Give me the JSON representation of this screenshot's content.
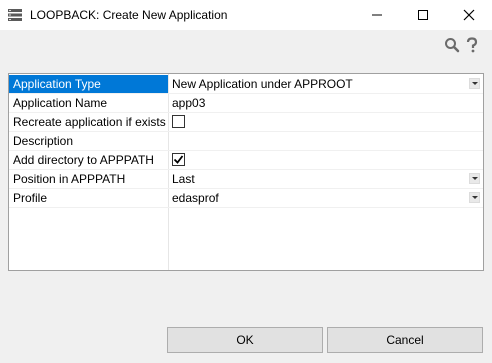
{
  "window": {
    "title": "LOOPBACK: Create New Application"
  },
  "icons": {
    "app": "server-stack-icon",
    "minimize": "minimize-icon",
    "maximize": "maximize-icon",
    "close": "close-icon",
    "search": "search-icon",
    "help": "help-icon"
  },
  "properties": [
    {
      "label": "Application Type",
      "value": "New Application under APPROOT",
      "control": "dropdown",
      "selected": true
    },
    {
      "label": "Application Name",
      "value": "app03",
      "control": "text"
    },
    {
      "label": "Recreate application if exists",
      "value": "",
      "control": "checkbox",
      "checked": false
    },
    {
      "label": "Description",
      "value": "",
      "control": "text"
    },
    {
      "label": "Add directory to APPPATH",
      "value": "",
      "control": "checkbox",
      "checked": true
    },
    {
      "label": "Position in APPPATH",
      "value": "Last",
      "control": "dropdown"
    },
    {
      "label": "Profile",
      "value": "edasprof",
      "control": "dropdown"
    }
  ],
  "buttons": {
    "ok": "OK",
    "cancel": "Cancel"
  },
  "colors": {
    "selection": "#0078d7"
  }
}
